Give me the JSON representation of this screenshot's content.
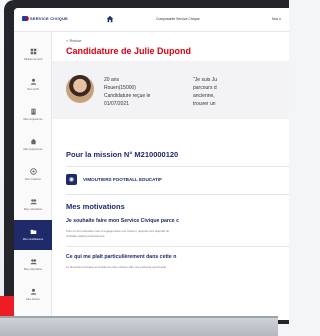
{
  "topbar": {
    "logo_text": "SERVICE CIVIQUE",
    "nav": [
      "Composante Service Civique",
      "Nos o"
    ]
  },
  "sidebar": {
    "items": [
      {
        "label": "Tableau de bord",
        "icon": "grid-icon",
        "active": false
      },
      {
        "label": "Mon profil",
        "icon": "user-icon",
        "active": false
      },
      {
        "label": "Mes organismes",
        "icon": "building-icon",
        "active": false
      },
      {
        "label": "Mes organismes",
        "icon": "home-icon",
        "active": false
      },
      {
        "label": "Mes missions",
        "icon": "target-icon",
        "active": false
      },
      {
        "label": "Mes volontaires",
        "icon": "users-icon",
        "active": false
      },
      {
        "label": "Mes candidatures",
        "icon": "folder-icon",
        "active": true
      },
      {
        "label": "Mes volontaires",
        "icon": "users-icon",
        "active": false
      },
      {
        "label": "Mes tuteurs",
        "icon": "user-icon",
        "active": false
      }
    ]
  },
  "main": {
    "back_label": "< Retour",
    "title": "Candidature de Julie Dupond",
    "profile": {
      "age": "20 ans",
      "city": "Rouen(15000)",
      "received_label": "Candidature reçue le",
      "received_date": "01/07/2021",
      "quote_lines": [
        "\"Je suis Ju",
        "parcours d",
        "ancienne,",
        "trouver un"
      ]
    },
    "mission_title": "Pour la mission N° M210000120",
    "association": "VIMOUTIERS FOOTBALL EDUCATIF",
    "motivations_title": "Mes motivations",
    "q1": "Je souhaite faire mon Service Civique parce c",
    "q1_body": [
      "Pour un fort volontaire c'est m'engager dans une mission, rejoindre des objectifs de",
      "véritable insights professionnel."
    ],
    "q2": "Ce qui me plaît particulièrement dans cette n",
    "q2_body": [
      "Le dimension humaine et sociale de cette mission offre une profonde opportunité"
    ]
  }
}
